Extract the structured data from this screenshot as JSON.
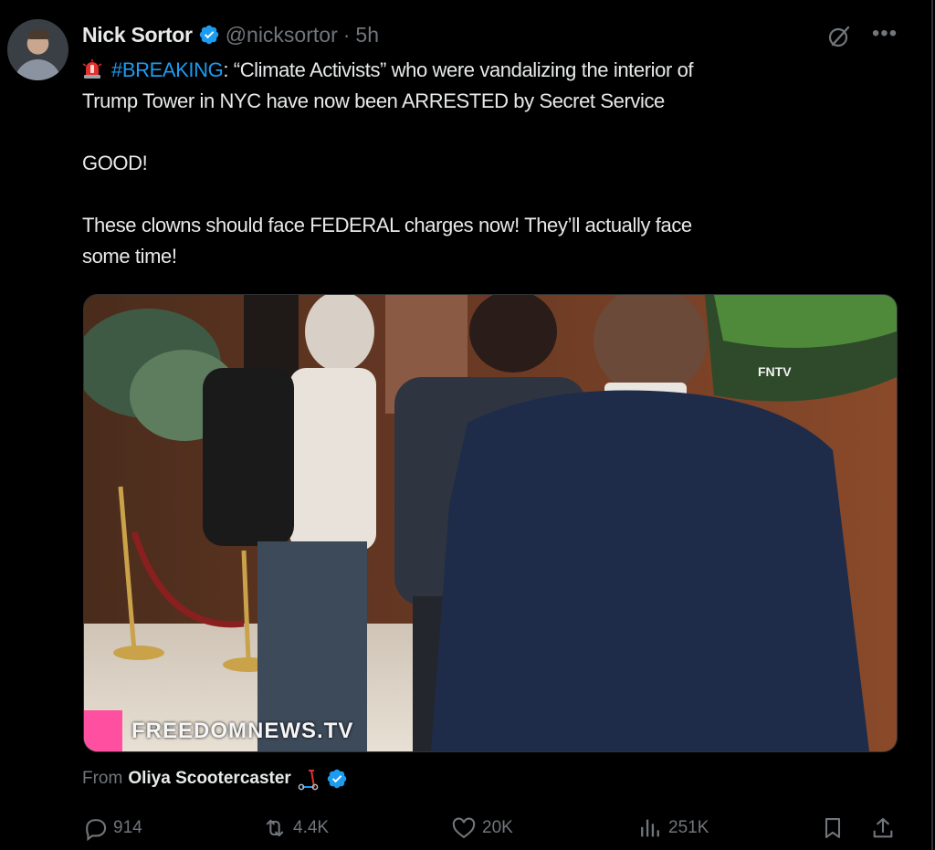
{
  "tweet": {
    "author_name": "Nick Sortor",
    "handle": "@nicksortor",
    "separator": "·",
    "time": "5h",
    "line1_hashtag": "#BREAKING",
    "line1_rest": ": “Climate Activists” who were vandalizing the interior of",
    "line2": "Trump Tower in NYC have now been ARRESTED by Secret Service",
    "para2": "GOOD!",
    "para3_line1": "These clowns should face FEDERAL charges now! They’ll actually face",
    "para3_line2": "some time!"
  },
  "media": {
    "watermark_brand": "FNTV",
    "watermark_site": "FREEDOMNEWS.TV"
  },
  "attribution": {
    "from_label": "From",
    "source_name": "Oliya Scootercaster"
  },
  "actions": {
    "replies": "914",
    "reposts": "4.4K",
    "likes": "20K",
    "views": "251K"
  },
  "icons": {
    "verified": "verified-badge-icon",
    "grok": "grok-icon",
    "more": "more-icon",
    "siren": "siren-emoji",
    "scooter": "scooter-emoji",
    "reply": "reply-icon",
    "repost": "repost-icon",
    "like": "like-icon",
    "views": "views-icon",
    "bookmark": "bookmark-icon",
    "share": "share-icon"
  },
  "colors": {
    "accent": "#1d9bf0",
    "muted": "#71767b",
    "text": "#e7e9ea",
    "background": "#000000"
  }
}
